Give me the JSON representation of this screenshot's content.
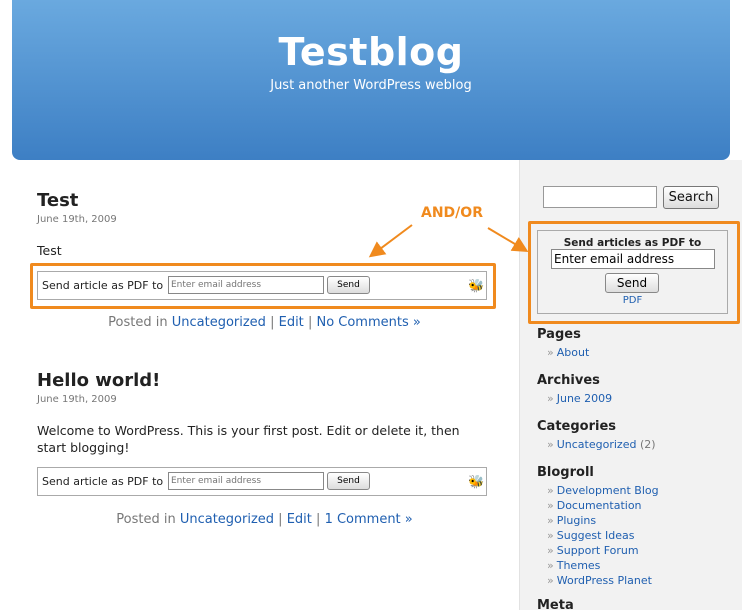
{
  "header": {
    "title": "Testblog",
    "description": "Just another WordPress weblog"
  },
  "annotation": {
    "label": "AND/OR",
    "color": "#f08a1e"
  },
  "posts": [
    {
      "title": "Test",
      "date": "June 19th, 2009",
      "body": "Test",
      "pdf_label": "Send article as PDF to",
      "pdf_placeholder": "Enter email address",
      "pdf_button": "Send",
      "meta_prefix": "Posted in",
      "category": "Uncategorized",
      "sep1": "|",
      "edit": "Edit",
      "sep2": "|",
      "comments": "No Comments »"
    },
    {
      "title": "Hello world!",
      "date": "June 19th, 2009",
      "body": "Welcome to WordPress. This is your first post. Edit or delete it, then start blogging!",
      "pdf_label": "Send article as PDF to",
      "pdf_placeholder": "Enter email address",
      "pdf_button": "Send",
      "meta_prefix": "Posted in",
      "category": "Uncategorized",
      "sep1": "|",
      "edit": "Edit",
      "sep2": "|",
      "comments": "1 Comment »"
    }
  ],
  "sidebar": {
    "search_button": "Search",
    "pdf_widget": {
      "title": "Send articles as PDF to",
      "input_value": "Enter email address",
      "button": "Send",
      "link": "PDF"
    },
    "pages": {
      "heading": "Pages",
      "items": [
        "About"
      ]
    },
    "archives": {
      "heading": "Archives",
      "items": [
        "June 2009"
      ]
    },
    "categories": {
      "heading": "Categories",
      "items": [
        {
          "name": "Uncategorized",
          "count": "(2)"
        }
      ]
    },
    "blogroll": {
      "heading": "Blogroll",
      "items": [
        "Development Blog",
        "Documentation",
        "Plugins",
        "Suggest Ideas",
        "Support Forum",
        "Themes",
        "WordPress Planet"
      ]
    },
    "meta": {
      "heading": "Meta"
    },
    "bullet": "»"
  },
  "colors": {
    "header_top": "#6aa9df",
    "header_bottom": "#3d7fc4",
    "link": "#1f5fb0",
    "highlight": "#f08a1e"
  }
}
